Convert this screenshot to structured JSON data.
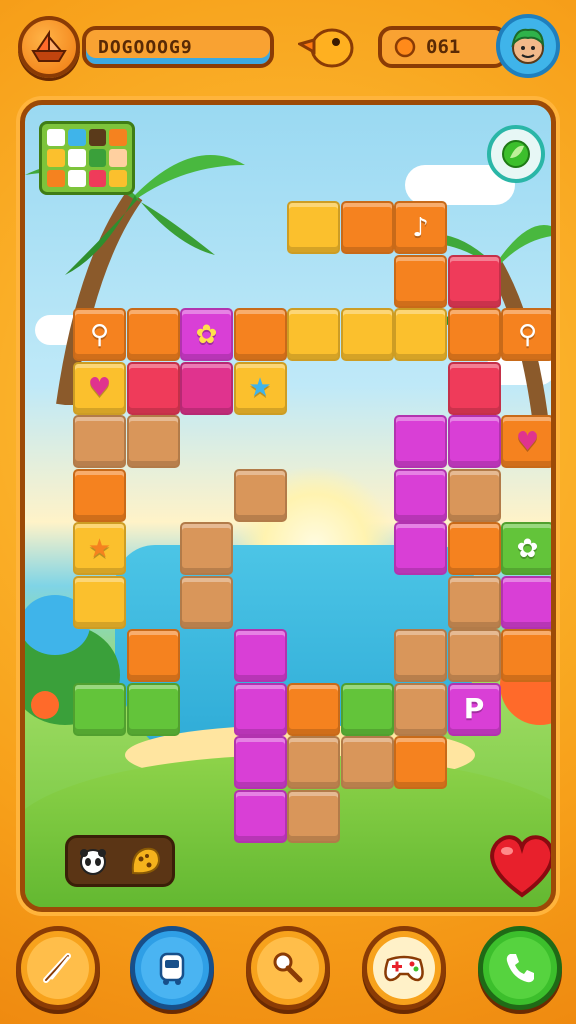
{
  "hud": {
    "score": "DOGOOOG9",
    "coins": "061",
    "ship_icon": "paper-boat-icon",
    "mascot_icon": "duck-icon",
    "coin_icon": "coin-icon",
    "avatar_icon": "player-avatar-icon"
  },
  "board": {
    "minimap_icon": "minimap-icon",
    "corner_button_icon": "hint-icon",
    "inventory": [
      "panda-icon",
      "cookie-icon"
    ],
    "heart_icon": "heart-icon",
    "tile_glyphs": {
      "music": "♪",
      "heart": "♥",
      "star": "★",
      "letter_p": "P",
      "leaf": "✿",
      "bone": "⚲"
    }
  },
  "toolbar": [
    {
      "name": "pencil-button",
      "icon": "pencil-icon",
      "color": "#f7a21c"
    },
    {
      "name": "robot-button",
      "icon": "robot-icon",
      "color": "#2f9fe6"
    },
    {
      "name": "search-button",
      "icon": "magnifier-icon",
      "color": "#f7a21c"
    },
    {
      "name": "gamepad-button",
      "icon": "gamepad-icon",
      "color": "#f7a21c"
    },
    {
      "name": "phone-button",
      "icon": "phone-icon",
      "color": "#3cbf2c"
    }
  ],
  "colors": {
    "orange": "#f5821f",
    "yellow": "#fbc02d",
    "pink": "#e0338e",
    "red": "#ef3b5a",
    "magenta": "#d93fd6",
    "green": "#63c43a",
    "sand": "#d9965a",
    "frame": "#f7a01a"
  }
}
